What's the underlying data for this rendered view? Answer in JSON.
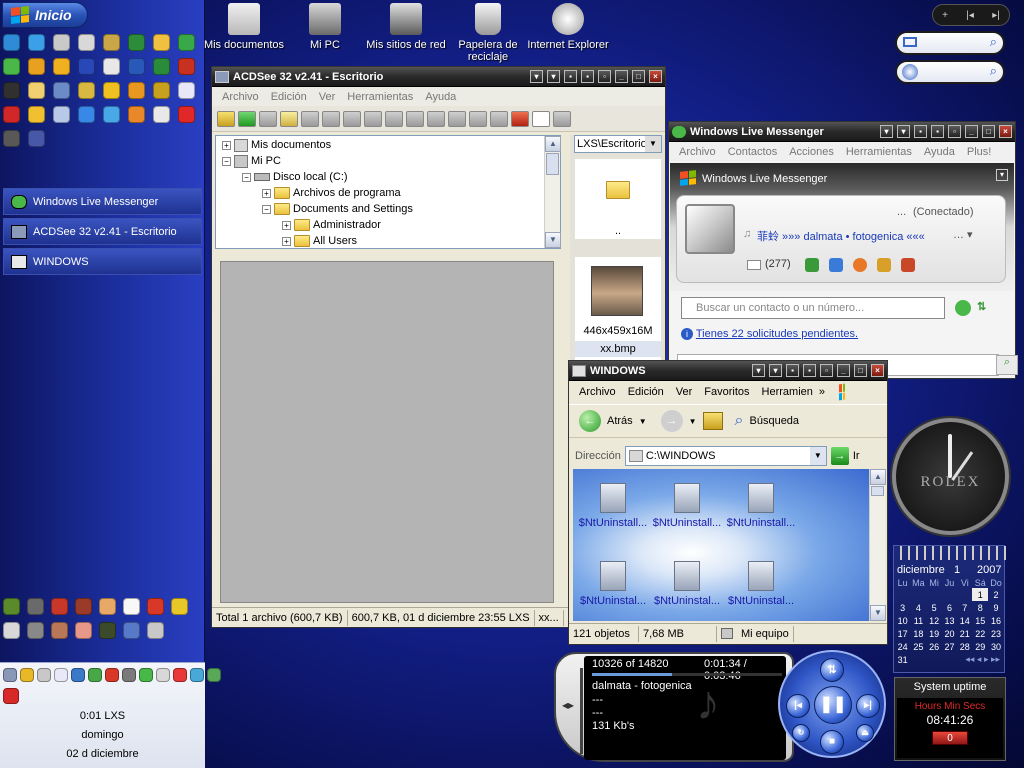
{
  "start": {
    "label": "Inicio"
  },
  "taskbar": {
    "items": [
      {
        "label": "Windows Live Messenger"
      },
      {
        "label": "ACDSee 32 v2.41 - Escritorio"
      },
      {
        "label": "WINDOWS"
      }
    ]
  },
  "clock_left": {
    "time": "0:01 LXS",
    "day": "domingo",
    "date": "02 d diciembre"
  },
  "desktop_icons": [
    {
      "label": "Mis documentos"
    },
    {
      "label": "Mi PC"
    },
    {
      "label": "Mis sitios de red"
    },
    {
      "label": "Papelera de reciclaje"
    },
    {
      "label": "Internet Explorer"
    }
  ],
  "acdsee": {
    "title": "ACDSee 32 v2.41 - Escritorio",
    "menu": [
      "Archivo",
      "Edición",
      "Ver",
      "Herramientas",
      "Ayuda"
    ],
    "tree": [
      {
        "label": "Mis documentos"
      },
      {
        "label": "Mi PC"
      },
      {
        "label": "Disco local (C:)"
      },
      {
        "label": "Archivos de programa"
      },
      {
        "label": "Documents and Settings"
      },
      {
        "label": "Administrador"
      },
      {
        "label": "All Users"
      }
    ],
    "path": "LXS\\Escritorio",
    "parent": "..",
    "thumb_size": "446x459x16M",
    "thumb_name": "xx.bmp",
    "status": [
      "Total 1 archivo (600,7 KB)",
      "600,7 KB, 01 d diciembre 23:55 LXS",
      "xx..."
    ]
  },
  "wlm": {
    "title": "Windows Live Messenger",
    "menu": [
      "Archivo",
      "Contactos",
      "Acciones",
      "Herramientas",
      "Ayuda",
      "Plus!"
    ],
    "brand": "Windows Live Messenger",
    "status_user": "...",
    "status": "(Conectado)",
    "personal_message": "菲蛉 »»» dalmata • fotogenica «««",
    "mail_count": "(277)",
    "search_placeholder": "Buscar un contacto o un número...",
    "pending": "Tienes 22 solicitudes pendientes."
  },
  "windows": {
    "title": "WINDOWS",
    "menu": [
      "Archivo",
      "Edición",
      "Ver",
      "Favoritos",
      "Herramien"
    ],
    "back": "Atrás",
    "search": "Búsqueda",
    "address_label": "Dirección",
    "address": "C:\\WINDOWS",
    "go": "Ir",
    "files": [
      "$NtUninstall...",
      "$NtUninstall...",
      "$NtUninstall...",
      "$NtUninstal...",
      "$NtUninstal...",
      "$NtUninstal..."
    ],
    "status": [
      "121 objetos",
      "7,68 MB",
      "Mi equipo"
    ]
  },
  "clock": {
    "brand": "ROLEX"
  },
  "calendar": {
    "month": "diciembre",
    "day": "1",
    "year": "2007",
    "weekdays": [
      "Lu",
      "Ma",
      "Mi",
      "Ju",
      "Vi",
      "Sá",
      "Do"
    ],
    "weeks": [
      [
        "",
        "",
        "",
        "",
        "",
        "1",
        "2"
      ],
      [
        "3",
        "4",
        "5",
        "6",
        "7",
        "8",
        "9"
      ],
      [
        "10",
        "11",
        "12",
        "13",
        "14",
        "15",
        "16"
      ],
      [
        "17",
        "18",
        "19",
        "20",
        "21",
        "22",
        "23"
      ],
      [
        "24",
        "25",
        "26",
        "27",
        "28",
        "29",
        "30"
      ],
      [
        "31",
        "",
        "",
        "",
        "",
        "",
        ""
      ]
    ]
  },
  "uptime": {
    "title": "System uptime",
    "label": "Hours Min Secs",
    "value": "08:41:26",
    "reset": "0"
  },
  "player": {
    "track_pos": "10326 of 14820",
    "time": "0:01:34 / 0:03:46",
    "title": "dalmata - fotogenica",
    "line2": "---",
    "line3": "---",
    "bitrate": "131 Kb's"
  }
}
